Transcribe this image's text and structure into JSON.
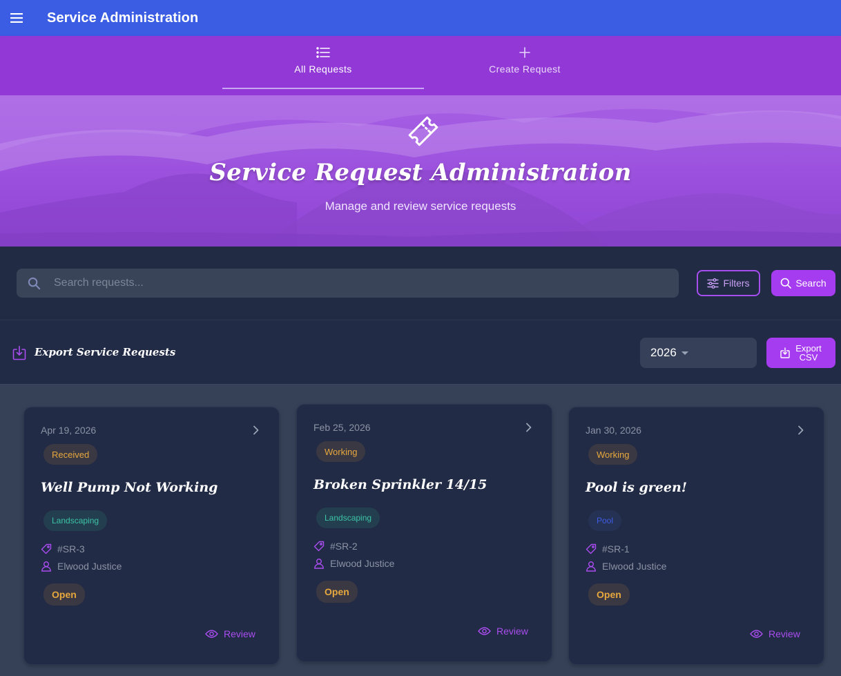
{
  "app": {
    "title": "Service Administration"
  },
  "tabs": [
    {
      "label": "All Requests",
      "icon": "list-icon",
      "active": true
    },
    {
      "label": "Create Request",
      "icon": "plus-icon",
      "active": false
    }
  ],
  "hero": {
    "icon": "ticket-icon",
    "title": "Service Request Administration",
    "subtitle": "Manage and review service requests"
  },
  "search": {
    "placeholder": "Search requests...",
    "value": "",
    "filters_label": "Filters",
    "search_label": "Search"
  },
  "export": {
    "title": "Export Service Requests",
    "year": "2026",
    "button_line1": "Export",
    "button_line2": "CSV"
  },
  "colors": {
    "appbar": "#3b5de4",
    "tabbar": "#9238d6",
    "accent": "#a53cf0",
    "status_text": "#e7a83e",
    "landscaping": "#3cc3a6",
    "pool": "#3f5ce6"
  },
  "cards": [
    {
      "date": "Apr 19, 2026",
      "status": "Received",
      "title": "Well Pump Not Working",
      "category": "Landscaping",
      "id": "#SR-3",
      "user": "Elwood Justice",
      "state": "Open",
      "action": "Review"
    },
    {
      "date": "Feb 25, 2026",
      "status": "Working",
      "title": "Broken Sprinkler 14/15",
      "category": "Landscaping",
      "id": "#SR-2",
      "user": "Elwood Justice",
      "state": "Open",
      "action": "Review"
    },
    {
      "date": "Jan 30, 2026",
      "status": "Working",
      "title": "Pool is green!",
      "category": "Pool",
      "id": "#SR-1",
      "user": "Elwood Justice",
      "state": "Open",
      "action": "Review"
    }
  ]
}
